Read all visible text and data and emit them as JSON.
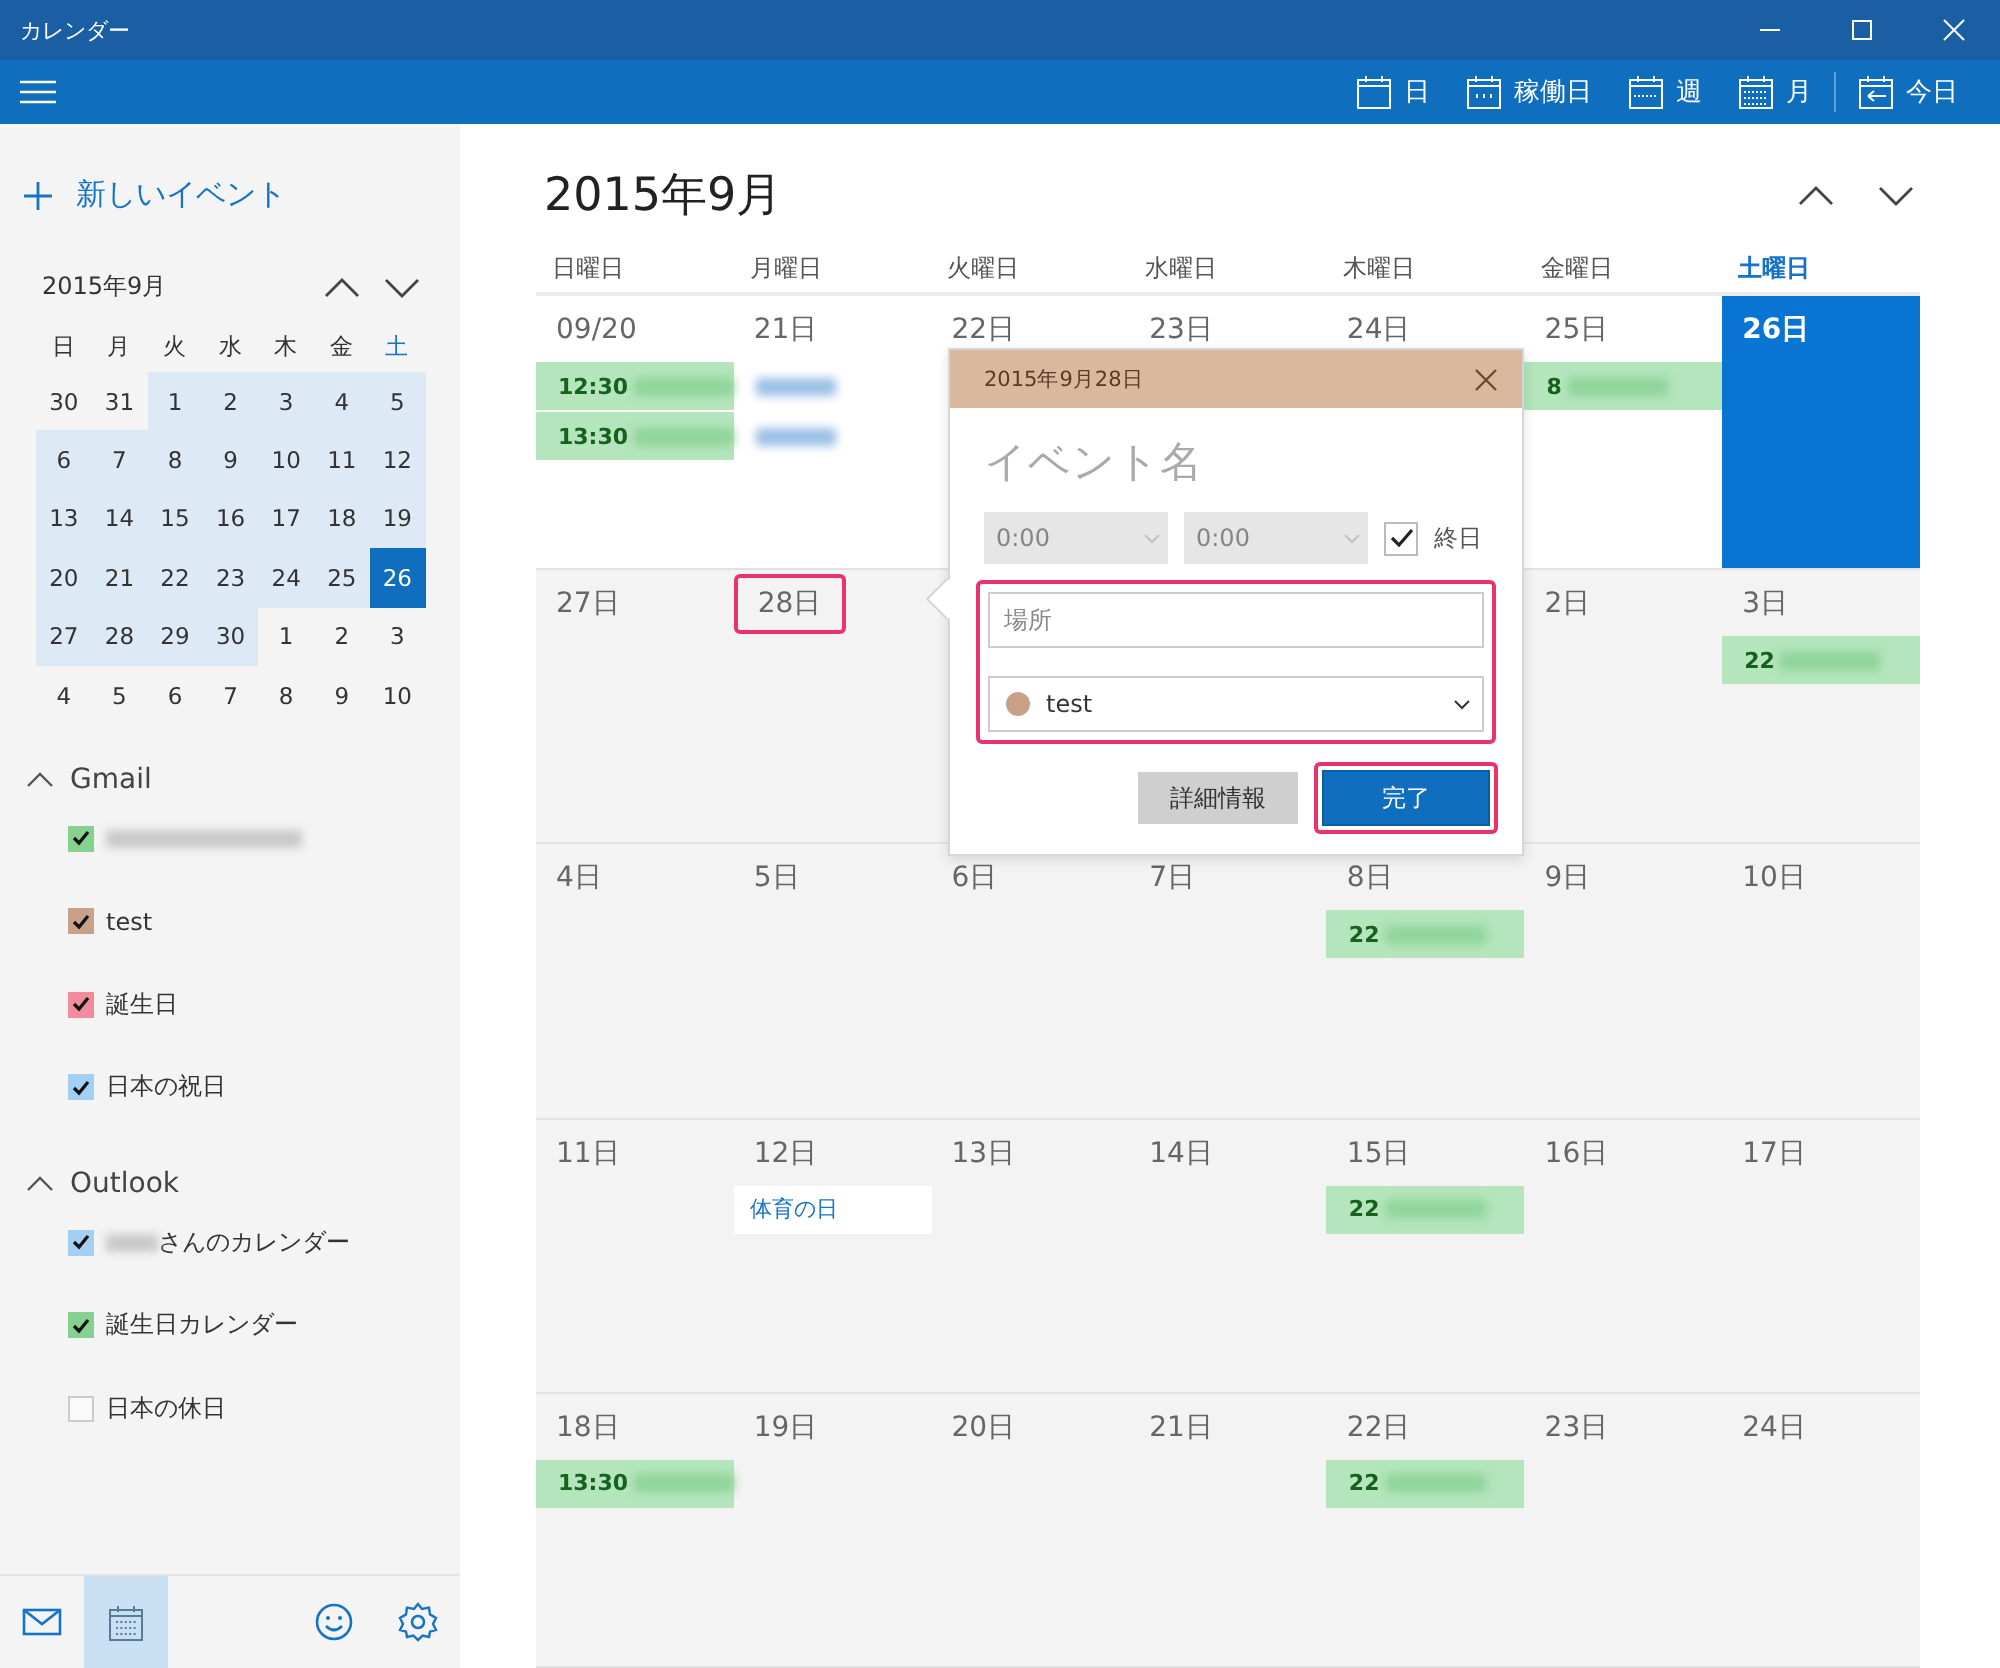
{
  "window": {
    "title": "カレンダー"
  },
  "toolbar": {
    "views": [
      {
        "kind": "day",
        "label": "日"
      },
      {
        "kind": "workweek",
        "label": "稼働日"
      },
      {
        "kind": "week",
        "label": "週"
      },
      {
        "kind": "month",
        "label": "月"
      },
      {
        "kind": "today",
        "label": "今日"
      }
    ]
  },
  "sidebar": {
    "new_event": "新しいイベント",
    "mini_calendar": {
      "title": "2015年9月",
      "weekdays": [
        {
          "label": "日",
          "current": false
        },
        {
          "label": "月",
          "current": false
        },
        {
          "label": "火",
          "current": false
        },
        {
          "label": "水",
          "current": false
        },
        {
          "label": "木",
          "current": false
        },
        {
          "label": "金",
          "current": false
        },
        {
          "label": "土",
          "current": true
        }
      ],
      "days": [
        {
          "label": "30",
          "in_month": false,
          "selected": false
        },
        {
          "label": "31",
          "in_month": false,
          "selected": false
        },
        {
          "label": "1",
          "in_month": true,
          "selected": false
        },
        {
          "label": "2",
          "in_month": true,
          "selected": false
        },
        {
          "label": "3",
          "in_month": true,
          "selected": false
        },
        {
          "label": "4",
          "in_month": true,
          "selected": false
        },
        {
          "label": "5",
          "in_month": true,
          "selected": false
        },
        {
          "label": "6",
          "in_month": true,
          "selected": false
        },
        {
          "label": "7",
          "in_month": true,
          "selected": false
        },
        {
          "label": "8",
          "in_month": true,
          "selected": false
        },
        {
          "label": "9",
          "in_month": true,
          "selected": false
        },
        {
          "label": "10",
          "in_month": true,
          "selected": false
        },
        {
          "label": "11",
          "in_month": true,
          "selected": false
        },
        {
          "label": "12",
          "in_month": true,
          "selected": false
        },
        {
          "label": "13",
          "in_month": true,
          "selected": false
        },
        {
          "label": "14",
          "in_month": true,
          "selected": false
        },
        {
          "label": "15",
          "in_month": true,
          "selected": false
        },
        {
          "label": "16",
          "in_month": true,
          "selected": false
        },
        {
          "label": "17",
          "in_month": true,
          "selected": false
        },
        {
          "label": "18",
          "in_month": true,
          "selected": false
        },
        {
          "label": "19",
          "in_month": true,
          "selected": false
        },
        {
          "label": "20",
          "in_month": true,
          "selected": false
        },
        {
          "label": "21",
          "in_month": true,
          "selected": false
        },
        {
          "label": "22",
          "in_month": true,
          "selected": false
        },
        {
          "label": "23",
          "in_month": true,
          "selected": false
        },
        {
          "label": "24",
          "in_month": true,
          "selected": false
        },
        {
          "label": "25",
          "in_month": true,
          "selected": false
        },
        {
          "label": "26",
          "in_month": true,
          "selected": true
        },
        {
          "label": "27",
          "in_month": true,
          "selected": false
        },
        {
          "label": "28",
          "in_month": true,
          "selected": false
        },
        {
          "label": "29",
          "in_month": true,
          "selected": false
        },
        {
          "label": "30",
          "in_month": true,
          "selected": false
        },
        {
          "label": "1",
          "in_month": false,
          "selected": false
        },
        {
          "label": "2",
          "in_month": false,
          "selected": false
        },
        {
          "label": "3",
          "in_month": false,
          "selected": false
        },
        {
          "label": "4",
          "in_month": false,
          "selected": false
        },
        {
          "label": "5",
          "in_month": false,
          "selected": false
        },
        {
          "label": "6",
          "in_month": false,
          "selected": false
        },
        {
          "label": "7",
          "in_month": false,
          "selected": false
        },
        {
          "label": "8",
          "in_month": false,
          "selected": false
        },
        {
          "label": "9",
          "in_month": false,
          "selected": false
        },
        {
          "label": "10",
          "in_month": false,
          "selected": false
        }
      ]
    },
    "accounts": [
      {
        "name": "Gmail",
        "expanded": true,
        "calendars": [
          {
            "redacted": true,
            "checked": true,
            "color": "#86d190"
          },
          {
            "label": "test",
            "redacted": false,
            "checked": true,
            "color": "#c9a088"
          },
          {
            "label": "誕生日",
            "redacted": false,
            "checked": true,
            "color": "#f28b9c"
          },
          {
            "label": "日本の祝日",
            "redacted": false,
            "checked": true,
            "color": "#a3cff2"
          }
        ]
      },
      {
        "name": "Outlook",
        "expanded": true,
        "calendars": [
          {
            "label": "さんのカレンダー",
            "redacted": true,
            "checked": true,
            "color": "#a3cff2"
          },
          {
            "label": "誕生日カレンダー",
            "redacted": false,
            "checked": true,
            "color": "#86d190"
          },
          {
            "label": "日本の休日",
            "redacted": false,
            "checked": false
          }
        ]
      }
    ],
    "bottom_nav": [
      {
        "kind": "mail",
        "selected": false
      },
      {
        "kind": "calendar",
        "selected": true
      },
      {
        "kind": "feedback",
        "selected": false
      },
      {
        "kind": "settings",
        "selected": false
      }
    ]
  },
  "month": {
    "title": "2015年9月",
    "weekdays": [
      {
        "label": "日曜日",
        "current": false
      },
      {
        "label": "月曜日",
        "current": false
      },
      {
        "label": "火曜日",
        "current": false
      },
      {
        "label": "水曜日",
        "current": false
      },
      {
        "label": "木曜日",
        "current": false
      },
      {
        "label": "金曜日",
        "current": false
      },
      {
        "label": "土曜日",
        "current": true
      }
    ],
    "weeks": [
      {
        "current": true,
        "days": [
          {
            "label": "09/20",
            "today": false,
            "highlighted": false,
            "events": [
              {
                "kind": "timed",
                "time": "12:30"
              },
              {
                "kind": "timed",
                "time": "13:30"
              }
            ]
          },
          {
            "label": "21日",
            "today": false,
            "highlighted": false,
            "events": [
              {
                "kind": "hidden"
              },
              {
                "kind": "hidden"
              }
            ]
          },
          {
            "label": "22日",
            "today": false,
            "highlighted": false
          },
          {
            "label": "23日",
            "today": false,
            "highlighted": false
          },
          {
            "label": "24日",
            "today": false,
            "highlighted": false
          },
          {
            "label": "25日",
            "today": false,
            "highlighted": false,
            "events": [
              {
                "kind": "timed",
                "time": "8"
              }
            ]
          },
          {
            "label": "26日",
            "today": true,
            "highlighted": false
          }
        ]
      },
      {
        "current": false,
        "days": [
          {
            "label": "27日",
            "today": false,
            "highlighted": false
          },
          {
            "label": "28日",
            "today": false,
            "highlighted": true
          }
        ],
        "days_after": [
          {
            "label": "2日",
            "today": false,
            "highlighted": false
          },
          {
            "label": "3日",
            "today": false,
            "highlighted": false,
            "events": [
              {
                "kind": "timed",
                "time": "22"
              }
            ]
          }
        ]
      },
      {
        "current": false,
        "days": [
          {
            "label": "4日",
            "today": false,
            "highlighted": false
          },
          {
            "label": "5日",
            "today": false,
            "highlighted": false
          },
          {
            "label": "6日",
            "today": false,
            "highlighted": false
          },
          {
            "label": "7日",
            "today": false,
            "highlighted": false
          },
          {
            "label": "8日",
            "today": false,
            "highlighted": false,
            "events": [
              {
                "kind": "timed",
                "time": "22"
              }
            ]
          },
          {
            "label": "9日",
            "today": false,
            "highlighted": false
          },
          {
            "label": "10日",
            "today": false,
            "highlighted": false
          }
        ]
      },
      {
        "current": false,
        "days": [
          {
            "label": "11日",
            "today": false,
            "highlighted": false
          },
          {
            "label": "12日",
            "today": false,
            "highlighted": false,
            "events": [
              {
                "kind": "holiday",
                "title": "体育の日"
              }
            ]
          },
          {
            "label": "13日",
            "today": false,
            "highlighted": false
          },
          {
            "label": "14日",
            "today": false,
            "highlighted": false
          },
          {
            "label": "15日",
            "today": false,
            "highlighted": false,
            "events": [
              {
                "kind": "timed",
                "time": "22"
              }
            ]
          },
          {
            "label": "16日",
            "today": false,
            "highlighted": false
          },
          {
            "label": "17日",
            "today": false,
            "highlighted": false
          }
        ]
      },
      {
        "current": false,
        "days": [
          {
            "label": "18日",
            "today": false,
            "highlighted": false,
            "events": [
              {
                "kind": "timed",
                "time": "13:30"
              }
            ]
          },
          {
            "label": "19日",
            "today": false,
            "highlighted": false
          },
          {
            "label": "20日",
            "today": false,
            "highlighted": false
          },
          {
            "label": "21日",
            "today": false,
            "highlighted": false
          },
          {
            "label": "22日",
            "today": false,
            "highlighted": false,
            "events": [
              {
                "kind": "timed",
                "time": "22"
              }
            ]
          },
          {
            "label": "23日",
            "today": false,
            "highlighted": false
          },
          {
            "label": "24日",
            "today": false,
            "highlighted": false
          }
        ]
      }
    ]
  },
  "popup": {
    "date": "2015年9月28日",
    "title_placeholder": "イベント名",
    "start_time": "0:00",
    "end_time": "0:00",
    "times_disabled": true,
    "all_day": {
      "label": "終日",
      "checked": true
    },
    "location_placeholder": "場所",
    "calendar": {
      "label": "test",
      "color": "#c9a088"
    },
    "fields_highlighted": true,
    "buttons": [
      {
        "kind": "secondary",
        "label": "詳細情報",
        "highlighted": false
      },
      {
        "kind": "primary",
        "label": "完了",
        "highlighted": true
      }
    ]
  }
}
